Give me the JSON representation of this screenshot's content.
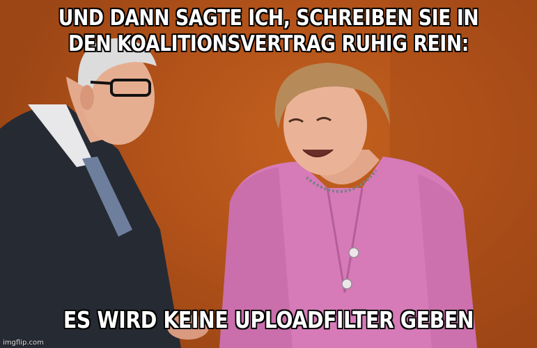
{
  "meme": {
    "top_text": "UND DANN SAGTE ICH, SCHREIBEN SIE IN DEN KOALITIONSVERTRAG RUHIG REIN:",
    "bottom_text": "ES WIRD KEINE UPLOADFILTER GEBEN",
    "watermark": "imgflip.com"
  },
  "colors": {
    "background": "#b5531a",
    "text": "#ffffff",
    "outline": "#000000",
    "jacket_pink": "#d67bb8",
    "suit_dark": "#2a2d36"
  }
}
